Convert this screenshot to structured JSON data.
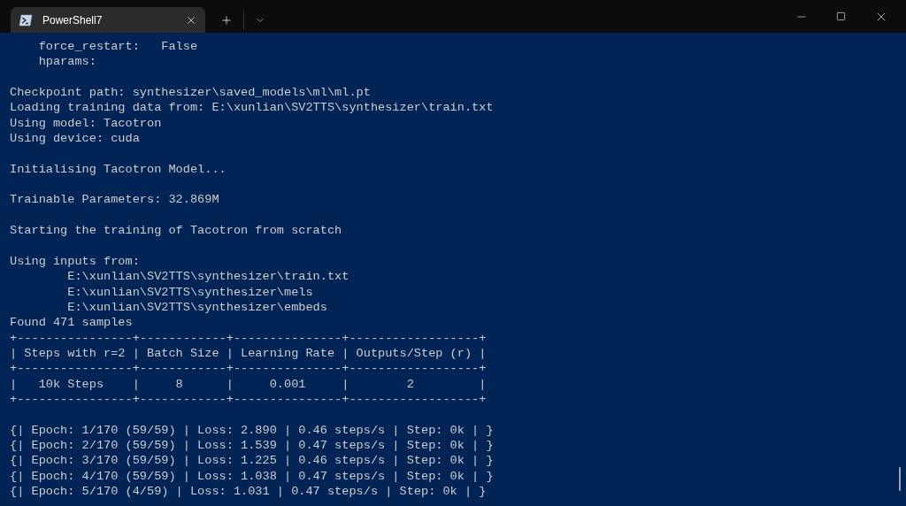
{
  "tabs": [
    {
      "label": "PowerShell7",
      "selected": true
    }
  ],
  "lines": [
    {
      "kind": "text",
      "text": "    force_restart:   False"
    },
    {
      "kind": "text",
      "text": "    hparams:"
    },
    {
      "kind": "blank"
    },
    {
      "kind": "text",
      "text": "Checkpoint path: synthesizer\\saved_models\\ml\\ml.pt"
    },
    {
      "kind": "text",
      "text": "Loading training data from: E:\\xunlian\\SV2TTS\\synthesizer\\train.txt"
    },
    {
      "kind": "text",
      "text": "Using model: Tacotron"
    },
    {
      "kind": "text",
      "text": "Using device: cuda"
    },
    {
      "kind": "blank"
    },
    {
      "kind": "text",
      "text": "Initialising Tacotron Model..."
    },
    {
      "kind": "blank"
    },
    {
      "kind": "text",
      "text": "Trainable Parameters: 32.869M"
    },
    {
      "kind": "blank"
    },
    {
      "kind": "text",
      "text": "Starting the training of Tacotron from scratch"
    },
    {
      "kind": "blank"
    },
    {
      "kind": "text",
      "text": "Using inputs from:"
    },
    {
      "kind": "text",
      "text": "        E:\\xunlian\\SV2TTS\\synthesizer\\train.txt"
    },
    {
      "kind": "text",
      "text": "        E:\\xunlian\\SV2TTS\\synthesizer\\mels"
    },
    {
      "kind": "text",
      "text": "        E:\\xunlian\\SV2TTS\\synthesizer\\embeds"
    },
    {
      "kind": "text",
      "text": "Found 471 samples"
    },
    {
      "kind": "text",
      "text": "+----------------+------------+---------------+------------------+"
    },
    {
      "kind": "text",
      "text": "| Steps with r=2 | Batch Size | Learning Rate | Outputs/Step (r) |"
    },
    {
      "kind": "text",
      "text": "+----------------+------------+---------------+------------------+"
    },
    {
      "kind": "text",
      "text": "|   10k Steps    |     8      |     0.001     |        2         |"
    },
    {
      "kind": "text",
      "text": "+----------------+------------+---------------+------------------+"
    },
    {
      "kind": "blank"
    },
    {
      "kind": "text",
      "text": "{| Epoch: 1/170 (59/59) | Loss: 2.890 | 0.46 steps/s | Step: 0k | }"
    },
    {
      "kind": "text",
      "text": "{| Epoch: 2/170 (59/59) | Loss: 1.539 | 0.47 steps/s | Step: 0k | }"
    },
    {
      "kind": "text",
      "text": "{| Epoch: 3/170 (59/59) | Loss: 1.225 | 0.46 steps/s | Step: 0k | }"
    },
    {
      "kind": "text",
      "text": "{| Epoch: 4/170 (59/59) | Loss: 1.038 | 0.47 steps/s | Step: 0k | }"
    },
    {
      "kind": "text",
      "text": "{| Epoch: 5/170 (4/59) | Loss: 1.031 | 0.47 steps/s | Step: 0k | }"
    }
  ]
}
